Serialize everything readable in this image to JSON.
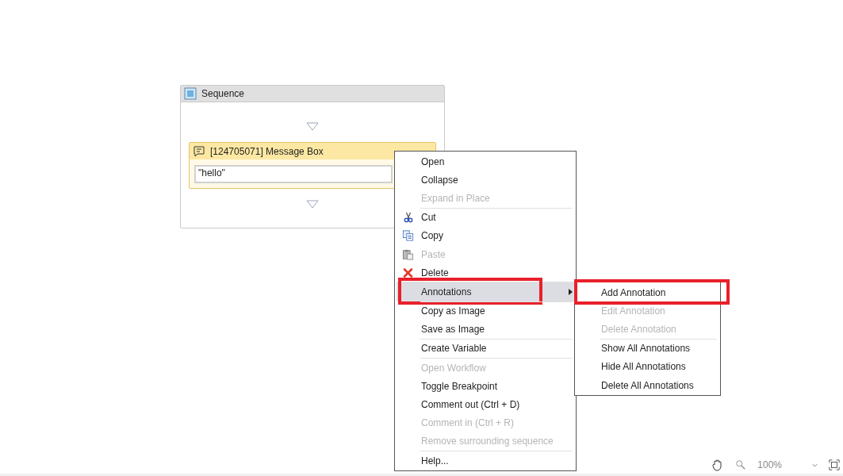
{
  "sequence": {
    "title": "Sequence",
    "activity": {
      "title": "[124705071] Message Box",
      "text": "\"hello\""
    }
  },
  "context_menu": {
    "items": [
      {
        "label": "Open",
        "disabled": false,
        "selected": false,
        "outlined": false,
        "separator_before": false
      },
      {
        "label": "Collapse",
        "disabled": false,
        "selected": false,
        "outlined": false,
        "separator_before": false
      },
      {
        "label": "Expand in Place",
        "disabled": true,
        "selected": false,
        "outlined": false,
        "separator_before": false
      },
      {
        "label": "Cut",
        "kind": "cut",
        "disabled": false,
        "selected": false,
        "outlined": false,
        "separator_before": true
      },
      {
        "label": "Copy",
        "kind": "copy",
        "disabled": false,
        "selected": false,
        "outlined": false,
        "separator_before": false
      },
      {
        "label": "Paste",
        "kind": "paste",
        "disabled": true,
        "selected": false,
        "outlined": false,
        "separator_before": false
      },
      {
        "label": "Delete",
        "kind": "delete",
        "disabled": false,
        "selected": false,
        "outlined": false,
        "separator_before": false
      },
      {
        "label": "Annotations",
        "submenu": true,
        "disabled": false,
        "selected": true,
        "outlined": true,
        "separator_before": true
      },
      {
        "label": "Copy as Image",
        "disabled": false,
        "selected": false,
        "outlined": false,
        "separator_before": true
      },
      {
        "label": "Save as Image",
        "disabled": false,
        "selected": false,
        "outlined": false,
        "separator_before": false
      },
      {
        "label": "Create Variable",
        "disabled": false,
        "selected": false,
        "outlined": false,
        "separator_before": true
      },
      {
        "label": "Open Workflow",
        "disabled": true,
        "selected": false,
        "outlined": false,
        "separator_before": true
      },
      {
        "label": "Toggle Breakpoint",
        "disabled": false,
        "selected": false,
        "outlined": false,
        "separator_before": false
      },
      {
        "label": "Comment out (Ctrl + D)",
        "disabled": false,
        "selected": false,
        "outlined": false,
        "separator_before": false
      },
      {
        "label": "Comment in (Ctrl + R)",
        "disabled": true,
        "selected": false,
        "outlined": false,
        "separator_before": false
      },
      {
        "label": "Remove surrounding sequence",
        "disabled": true,
        "selected": false,
        "outlined": false,
        "separator_before": false
      },
      {
        "label": "Help...",
        "disabled": false,
        "selected": false,
        "outlined": false,
        "separator_before": true
      }
    ]
  },
  "submenu": {
    "items": [
      {
        "label": "Add Annotation",
        "disabled": false,
        "outlined": true,
        "separator_before": false
      },
      {
        "label": "Edit Annotation",
        "disabled": true,
        "outlined": false,
        "separator_before": false
      },
      {
        "label": "Delete Annotation",
        "disabled": true,
        "outlined": false,
        "separator_before": false
      },
      {
        "label": "Show All Annotations",
        "disabled": false,
        "outlined": false,
        "separator_before": true
      },
      {
        "label": "Hide All Annotations",
        "disabled": false,
        "outlined": false,
        "separator_before": false
      },
      {
        "label": "Delete All Annotations",
        "disabled": false,
        "outlined": false,
        "separator_before": false
      }
    ]
  },
  "status_bar": {
    "zoom": "100%"
  }
}
